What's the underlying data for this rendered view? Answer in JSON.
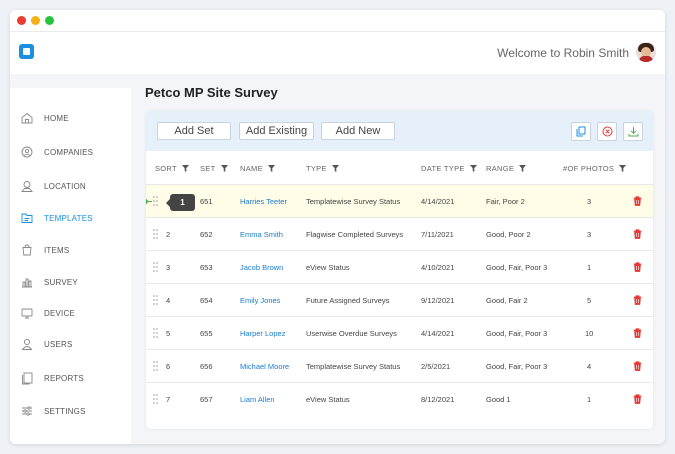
{
  "header": {
    "welcome": "Welcome to Robin Smith"
  },
  "sidebar": {
    "items": [
      {
        "label": "HOME",
        "icon": "home-icon"
      },
      {
        "label": "COMPANIES",
        "icon": "companies-icon"
      },
      {
        "label": "LOCATION",
        "icon": "location-icon"
      },
      {
        "label": "TEMPLATES",
        "icon": "templates-icon",
        "active": true
      },
      {
        "label": "ITEMS",
        "icon": "items-icon"
      },
      {
        "label": "SURVEY",
        "icon": "survey-icon"
      },
      {
        "label": "DEVICE",
        "icon": "device-icon"
      },
      {
        "label": "USERS",
        "icon": "users-icon"
      },
      {
        "label": "REPORTS",
        "icon": "reports-icon"
      },
      {
        "label": "SETTINGS",
        "icon": "settings-icon"
      }
    ]
  },
  "page": {
    "title": "Petco MP Site Survey"
  },
  "toolbar": {
    "add_set": "Add Set",
    "add_existing": "Add Existing",
    "add_new": "Add New",
    "icons": [
      "copy-icon",
      "cancel-icon",
      "download-icon"
    ]
  },
  "table": {
    "columns": {
      "sort": "SORT",
      "set": "SET",
      "name": "NAME",
      "type": "TYPE",
      "date_type": "DATE TYPE",
      "range": "RANGE",
      "photos": "#OF PHOTOS"
    },
    "tooltip": "1",
    "rows": [
      {
        "sort": "",
        "set": "651",
        "name": "Harries Teeter",
        "type": "Templatewise Survey Status",
        "date": "4/14/2021",
        "range": "Fair, Poor 2",
        "photos": "3"
      },
      {
        "sort": "2",
        "set": "652",
        "name": "Emma Smith",
        "type": "Flagwise Completed Surveys",
        "date": "7/11/2021",
        "range": "Good, Poor 2",
        "photos": "3"
      },
      {
        "sort": "3",
        "set": "653",
        "name": "Jacob Brown",
        "type": "eView Status",
        "date": "4/10/2021",
        "range": "Good, Fair, Poor 3",
        "photos": "1"
      },
      {
        "sort": "4",
        "set": "654",
        "name": "Emily Jones",
        "type": "Future Assigned Surveys",
        "date": "9/12/2021",
        "range": "Good, Fair 2",
        "photos": "5"
      },
      {
        "sort": "5",
        "set": "655",
        "name": "Harper Lopez",
        "type": "Userwise Overdue Surveys",
        "date": "4/14/2021",
        "range": "Good, Fair, Poor 3",
        "photos": "10"
      },
      {
        "sort": "6",
        "set": "656",
        "name": "Michael Moore",
        "type": "Templatewise Survey Status",
        "date": "2/5/2021",
        "range": "Good, Fair, Poor 3",
        "photos": "4"
      },
      {
        "sort": "7",
        "set": "657",
        "name": "Liam Allen",
        "type": "eView Status",
        "date": "8/12/2021",
        "range": "Good 1",
        "photos": "1"
      }
    ]
  },
  "colors": {
    "accent": "#1a8fe0",
    "delete": "#e53935",
    "highlight_row": "#fffde7",
    "toolbar_bg": "#e6f0fb"
  }
}
